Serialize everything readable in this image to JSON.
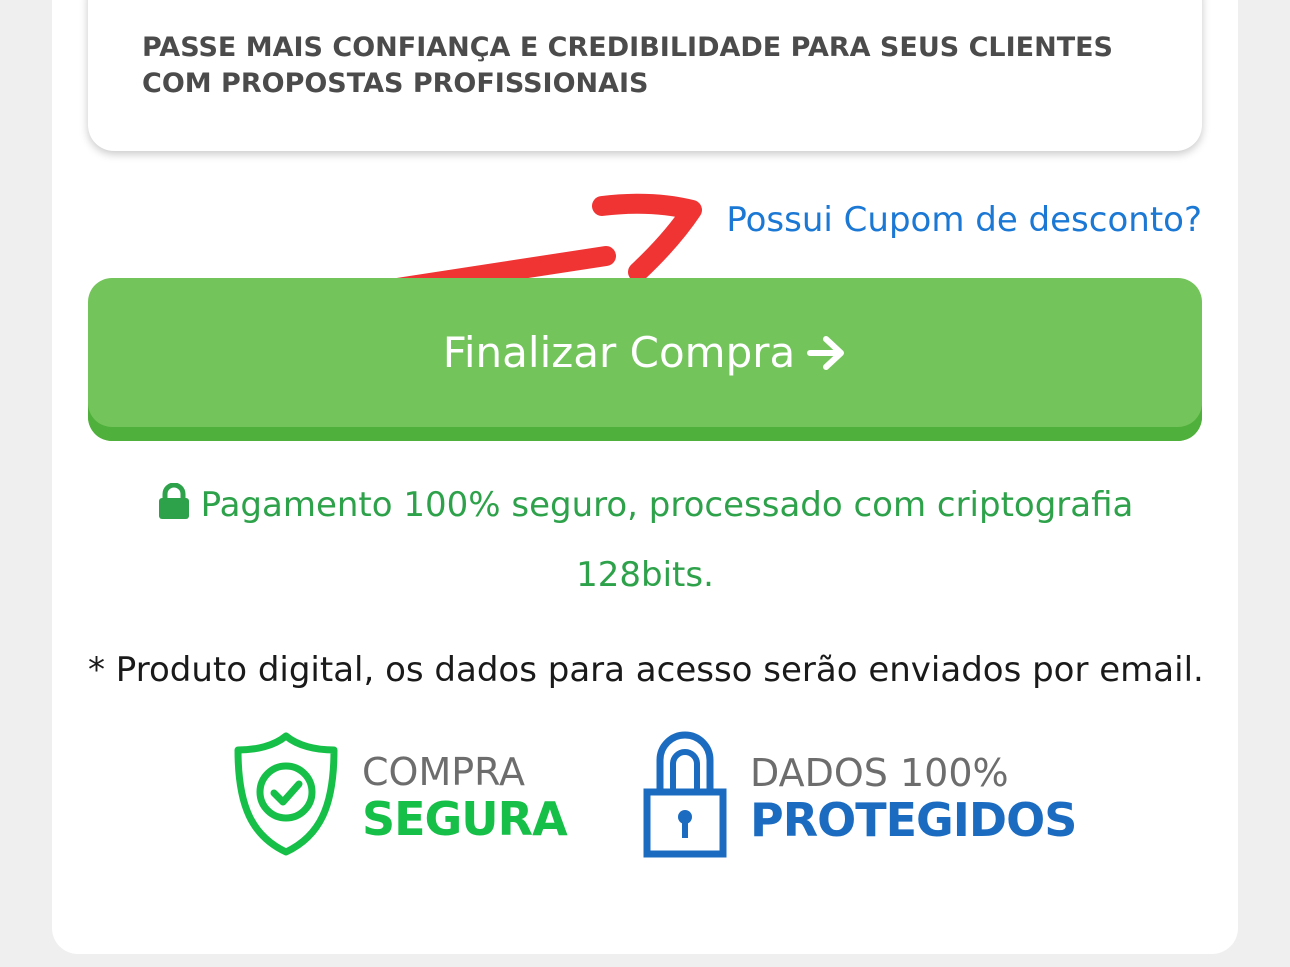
{
  "feature": {
    "text": "PASSE MAIS CONFIANÇA E CREDIBILIDADE PARA SEUS CLIENTES COM PROPOSTAS PROFISSIONAIS"
  },
  "coupon": {
    "label": "Possui Cupom de desconto?"
  },
  "annotation": {
    "color": "#f03434"
  },
  "checkout": {
    "label": "Finalizar Compra",
    "icon": "arrow-right-icon",
    "color": "#73c45a"
  },
  "security": {
    "line1": "Pagamento 100% seguro, processado com criptografia",
    "line2": "128bits.",
    "icon": "lock-icon",
    "color": "#2ea24a"
  },
  "note": {
    "text": "* Produto digital, os dados para acesso serão enviados por email."
  },
  "badges": {
    "secure": {
      "top": "COMPRA",
      "bottom": "SEGURA",
      "icon": "shield-check-icon",
      "color": "#16bf47"
    },
    "data": {
      "top": "DADOS 100%",
      "bottom": "PROTEGIDOS",
      "icon": "padlock-icon",
      "color": "#1b6cc0"
    }
  }
}
